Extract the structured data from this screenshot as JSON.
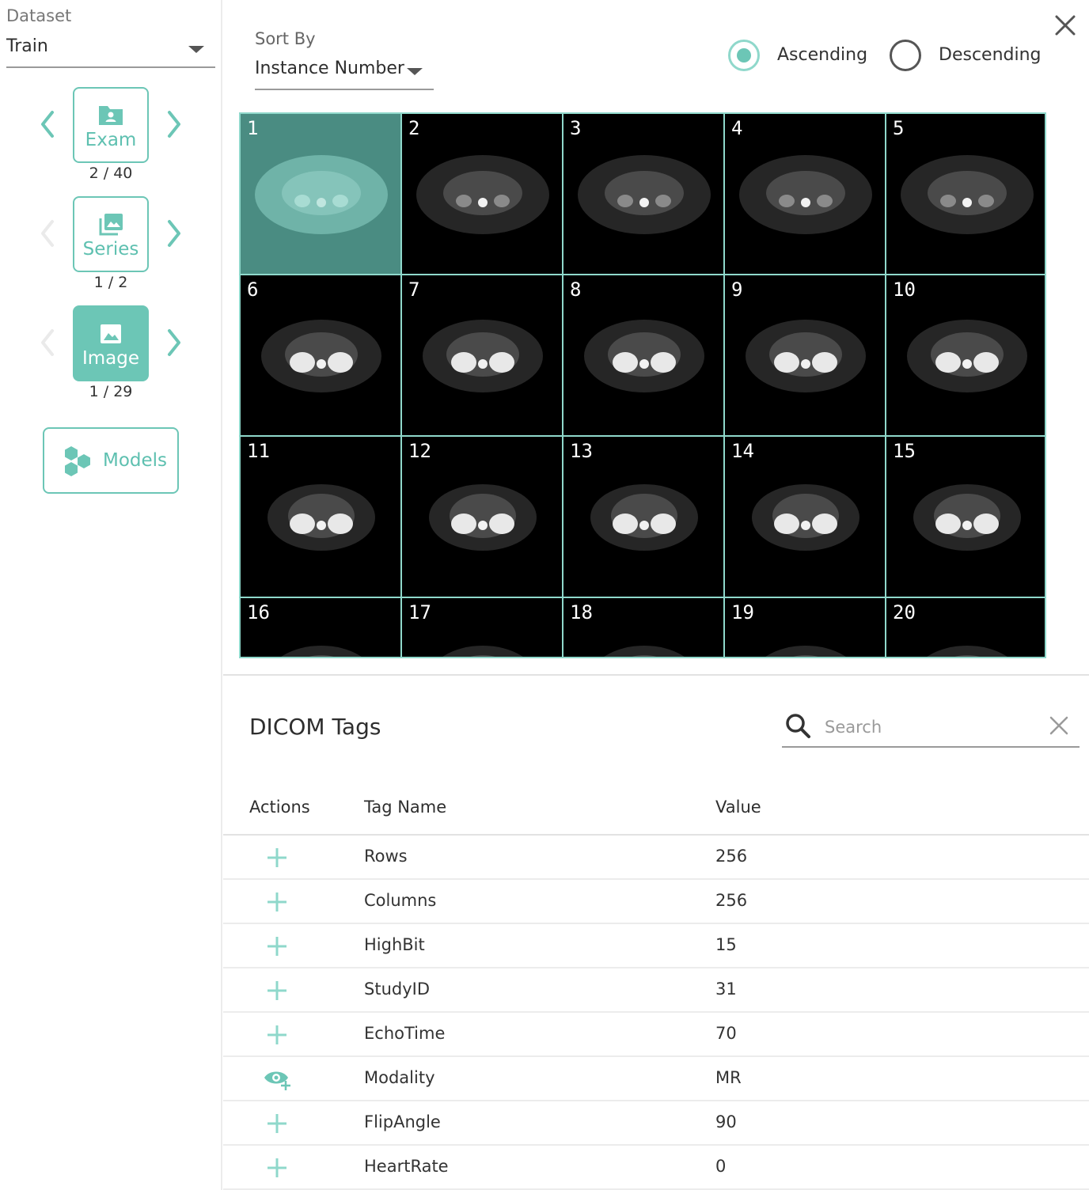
{
  "sidebar": {
    "dataset_label": "Dataset",
    "dataset_value": "Train",
    "exam": {
      "label": "Exam",
      "count": "2 / 40"
    },
    "series": {
      "label": "Series",
      "count": "1 / 2"
    },
    "image": {
      "label": "Image",
      "count": "1 / 29"
    },
    "models_label": "Models"
  },
  "sort": {
    "label": "Sort By",
    "value": "Instance Number",
    "ascending_label": "Ascending",
    "descending_label": "Descending",
    "selected": "ascending"
  },
  "grid": {
    "thumbnails": [
      "1",
      "2",
      "3",
      "4",
      "5",
      "6",
      "7",
      "8",
      "9",
      "10",
      "11",
      "12",
      "13",
      "14",
      "15",
      "16",
      "17",
      "18",
      "19",
      "20"
    ],
    "selected": "1"
  },
  "tags": {
    "title": "DICOM Tags",
    "search_placeholder": "Search",
    "headers": {
      "actions": "Actions",
      "tag_name": "Tag Name",
      "value": "Value"
    },
    "rows": [
      {
        "name": "Rows",
        "value": "256",
        "action": "add-icon"
      },
      {
        "name": "Columns",
        "value": "256",
        "action": "add-icon"
      },
      {
        "name": "HighBit",
        "value": "15",
        "action": "add-icon"
      },
      {
        "name": "StudyID",
        "value": "31",
        "action": "add-icon"
      },
      {
        "name": "EchoTime",
        "value": "70",
        "action": "add-icon"
      },
      {
        "name": "Modality",
        "value": "MR",
        "action": "eye-add-icon"
      },
      {
        "name": "FlipAngle",
        "value": "90",
        "action": "add-icon"
      },
      {
        "name": "HeartRate",
        "value": "0",
        "action": "add-icon"
      }
    ]
  },
  "colors": {
    "accent": "#6cc6b6",
    "accent_light": "#8fd8cb",
    "selected_thumb": "#4a8c82"
  }
}
